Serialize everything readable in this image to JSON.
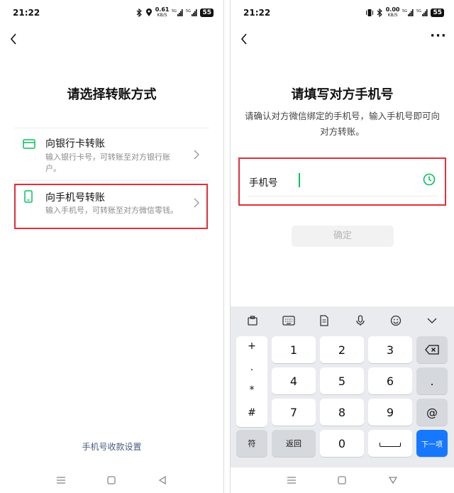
{
  "left": {
    "status": {
      "time": "21:22",
      "speed_value": "0.61",
      "speed_unit": "KB/S",
      "battery": "55"
    },
    "title": "请选择转账方式",
    "options": [
      {
        "title": "向银行卡转账",
        "desc": "输入银行卡号，可转账至对方银行账户。"
      },
      {
        "title": "向手机号转账",
        "desc": "输入手机号，可转账至对方微信零钱。"
      }
    ],
    "footer_link": "手机号收款设置",
    "colors": {
      "accent": "#07c160",
      "highlight": "#e0303a",
      "link": "#4a5b80"
    }
  },
  "right": {
    "status": {
      "time": "21:22",
      "speed_value": "0.00",
      "speed_unit": "KB/S",
      "battery": "55"
    },
    "title": "请填写对方手机号",
    "subtitle": "请确认对方微信绑定的手机号，输入手机号即可向对方转账。",
    "field_label": "手机号",
    "confirm_label": "确定",
    "keyboard": {
      "symbols": [
        "+",
        ".",
        "*",
        "#"
      ],
      "rows": [
        [
          "1",
          "2",
          "3"
        ],
        [
          "4",
          "5",
          "6"
        ],
        [
          "7",
          "8",
          "9"
        ]
      ],
      "dot": ".",
      "at": "@",
      "fu": "符",
      "back": "返回",
      "zero": "0",
      "next": "下一项"
    }
  }
}
